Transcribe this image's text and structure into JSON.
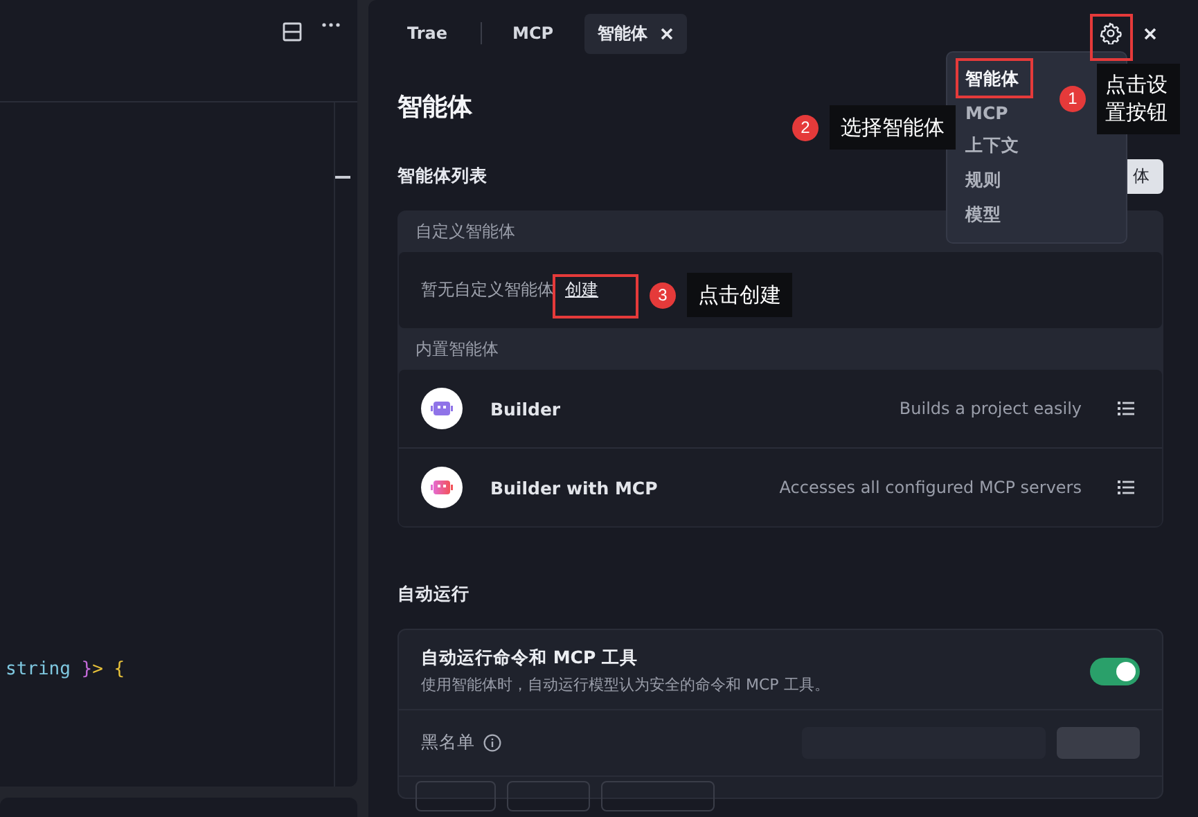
{
  "editor": {
    "code_tokens": [
      {
        "text": "string",
        "kind": "type"
      },
      {
        "text": " }",
        "kind": "brace"
      },
      {
        "text": ">",
        "kind": "punct"
      },
      {
        "text": " {",
        "kind": "punct"
      }
    ]
  },
  "tabs": [
    {
      "label": "Trae",
      "selected": false,
      "closable": false
    },
    {
      "label": "MCP",
      "selected": false,
      "closable": false
    },
    {
      "label": "智能体",
      "selected": true,
      "closable": true
    }
  ],
  "page_title": "智能体",
  "agent_list": {
    "title": "智能体列表",
    "button_label": "体",
    "custom": {
      "heading": "自定义智能体",
      "empty_text": "暂无自定义智能体",
      "create_link": "创建"
    },
    "builtin": {
      "heading": "内置智能体",
      "agents": [
        {
          "name": "Builder",
          "description": "Builds a project easily",
          "kind": "robot"
        },
        {
          "name": "Builder with MCP",
          "description": "Accesses all configured MCP servers",
          "kind": "mcp"
        }
      ]
    }
  },
  "auto_run": {
    "title": "自动运行",
    "toggle_label": "自动运行命令和 MCP 工具",
    "toggle_description": "使用智能体时，自动运行模型认为安全的命令和 MCP 工具。",
    "on": true,
    "blacklist_label": "黑名单"
  },
  "settings_menu": {
    "items": [
      {
        "label": "智能体",
        "selected": true
      },
      {
        "label": "MCP",
        "selected": false
      },
      {
        "label": "上下文",
        "selected": false
      },
      {
        "label": "规则",
        "selected": false
      },
      {
        "label": "模型",
        "selected": false
      }
    ]
  },
  "annotations": [
    {
      "number": "1",
      "text": "点击设置按钮"
    },
    {
      "number": "2",
      "text": "选择智能体"
    },
    {
      "number": "3",
      "text": "点击创建"
    }
  ]
}
